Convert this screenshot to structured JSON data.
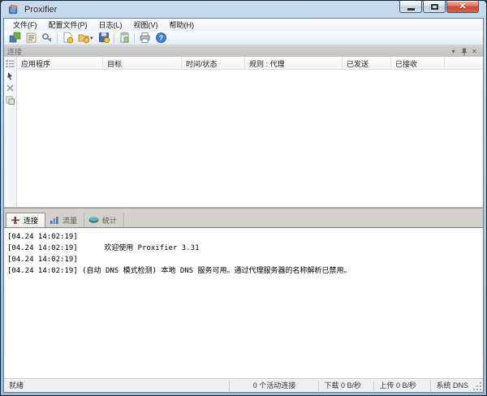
{
  "window": {
    "title": "Proxifier",
    "icons": {
      "app": "proxifier-logo",
      "minimize": "minimize-icon",
      "maximize": "maximize-icon",
      "close": "close-icon"
    }
  },
  "menubar": {
    "items": [
      {
        "label": "文件(F)"
      },
      {
        "label": "配置文件(P)"
      },
      {
        "label": "日志(L)"
      },
      {
        "label": "视图(V)"
      },
      {
        "label": "帮助(H)"
      }
    ]
  },
  "toolbar": {
    "icons": [
      "proxy-settings-icon",
      "proxification-rules-icon",
      "name-resolution-icon",
      "new-profile-icon",
      "open-profile-icon",
      "save-profile-icon",
      "system-tray-icon",
      "print-icon",
      "help-icon"
    ],
    "open_profile_caret": "▾"
  },
  "connections_panel": {
    "caption": "连接",
    "caption_buttons": {
      "menu_glyph": "▾",
      "pin_icon": "pin-icon",
      "close_glyph": "✕"
    },
    "columns": [
      {
        "label": "应用程序"
      },
      {
        "label": "目标"
      },
      {
        "label": "时间/状态"
      },
      {
        "label": "规则 : 代理"
      },
      {
        "label": "已发送"
      },
      {
        "label": "已接收"
      }
    ],
    "side_icons": [
      "view-details-icon",
      "cursor-icon",
      "terminate-connection-icon",
      "copy-icon"
    ]
  },
  "tabs": [
    {
      "label": "连接",
      "icon": "connections-tab-icon",
      "active": true
    },
    {
      "label": "流量",
      "icon": "traffic-tab-icon",
      "active": false
    },
    {
      "label": "统计",
      "icon": "statistics-tab-icon",
      "active": false
    }
  ],
  "log": {
    "lines": [
      "[04.24 14:02:19]",
      "[04.24 14:02:19]      欢迎使用 Proxifier 3.31",
      "[04.24 14:02:19]",
      "[04.24 14:02:19] (自动 DNS 模式检测) 本地 DNS 服务可用。通过代理服务器的名称解析已禁用。"
    ]
  },
  "statusbar": {
    "state": "就绪",
    "active_connections": "0 个活动连接",
    "download": "下载 0 B/秒",
    "upload": "上传 0 B/秒",
    "dns": "系统 DNS"
  },
  "colors": {
    "titlebar_glass": "#b4cce1",
    "close_button": "#cc4c33",
    "frame_bg": "#f0f0f0",
    "caption_bg": "#c9c9c9",
    "tabstrip_bg": "#d5d2cb",
    "accent_border": "#5f7f9c"
  }
}
